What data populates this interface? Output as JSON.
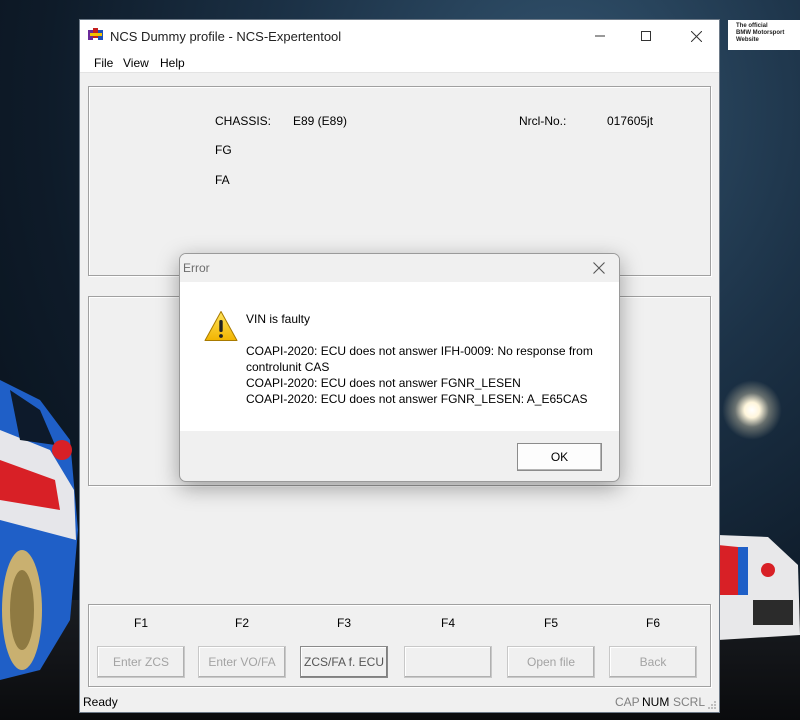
{
  "window": {
    "title": "NCS Dummy profile - NCS-Expertentool",
    "icon": "ncs-app-icon",
    "controls": {
      "minimize": "minimize-icon",
      "maximize": "maximize-icon",
      "close": "close-icon"
    }
  },
  "menu": {
    "file": "File",
    "view": "View",
    "help": "Help"
  },
  "info": {
    "chassis_label": "CHASSIS:",
    "chassis_value": "E89 (E89)",
    "nrcl_label": "Nrcl-No.:",
    "nrcl_value": "017605jt",
    "fg_label": "FG",
    "fa_label": "FA"
  },
  "function_keys": {
    "f1": "F1",
    "f2": "F2",
    "f3": "F3",
    "f4": "F4",
    "f5": "F5",
    "f6": "F6"
  },
  "function_buttons": {
    "f1": "Enter ZCS",
    "f2": "Enter VO/FA",
    "f3": "ZCS/FA f. ECU",
    "f4": "",
    "f5": "Open file",
    "f6": "Back"
  },
  "status": {
    "text": "Ready",
    "cap": "CAP",
    "num": "NUM",
    "scrl": "SCRL"
  },
  "dialog": {
    "title": "Error",
    "icon": "warning-icon",
    "heading": "VIN is faulty",
    "line1": "COAPI-2020: ECU does not answer  IFH-0009: No response from",
    "line1b": "controlunit  CAS",
    "line2": "COAPI-2020: ECU does not answer  FGNR_LESEN",
    "line3": "COAPI-2020: ECU does not answer  FGNR_LESEN: A_E65CAS",
    "ok_label": "OK"
  },
  "wallpaper": {
    "logo_line1": "The official",
    "logo_line2": "BMW Motorsport",
    "logo_line3": "Website"
  },
  "colors": {
    "window_bg": "#f0f0f0",
    "title_bg": "#ffffff",
    "disabled_text": "#a3a3a3",
    "warning_yellow": "#f5c400"
  }
}
